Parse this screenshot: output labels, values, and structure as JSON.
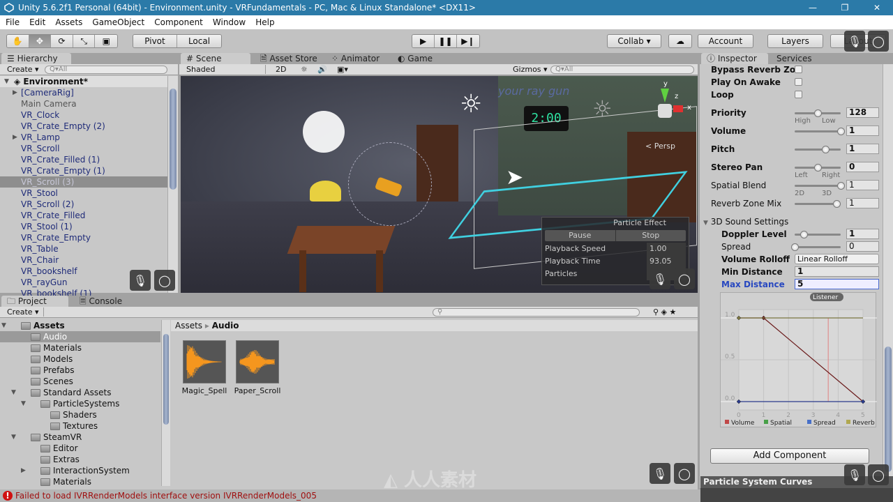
{
  "window": {
    "title": "Unity 5.6.2f1 Personal (64bit) - Environment.unity - VRFundamentals - PC, Mac & Linux Standalone* <DX11>",
    "minimize": "—",
    "maximize": "❐",
    "close": "✕"
  },
  "menu": [
    "File",
    "Edit",
    "Assets",
    "GameObject",
    "Component",
    "Window",
    "Help"
  ],
  "toolbar": {
    "tools": [
      "✋",
      "✥",
      "⟳",
      "⤡",
      "▣"
    ],
    "active_tool": 1,
    "pivot": "Pivot",
    "local": "Local",
    "play": "▶",
    "pause": "❚❚",
    "step": "▶❙",
    "collab": "Collab ▾",
    "cloud": "☁",
    "account": "Account",
    "layers": "Layers",
    "layout": "Layout"
  },
  "hierarchy": {
    "tab": "Hierarchy",
    "create": "Create ▾",
    "search_placeholder": "Q▾All",
    "scene": "Environment*",
    "selected": 8,
    "items": [
      {
        "label": "[CameraRig]",
        "expand": true,
        "color": "#1e2a78"
      },
      {
        "label": "Main Camera",
        "color": "#555555"
      },
      {
        "label": "VR_Clock"
      },
      {
        "label": "VR_Crate_Empty (2)"
      },
      {
        "label": "VR_Lamp",
        "expand": true
      },
      {
        "label": "VR_Scroll"
      },
      {
        "label": "VR_Crate_Filled (1)"
      },
      {
        "label": "VR_Crate_Empty (1)"
      },
      {
        "label": "VR_Scroll (3)"
      },
      {
        "label": "VR_Stool"
      },
      {
        "label": "VR_Scroll (2)"
      },
      {
        "label": "VR_Crate_Filled"
      },
      {
        "label": "VR_Stool (1)"
      },
      {
        "label": "VR_Crate_Empty"
      },
      {
        "label": "VR_Table"
      },
      {
        "label": "VR_Chair"
      },
      {
        "label": "VR_bookshelf"
      },
      {
        "label": "VR_rayGun"
      },
      {
        "label": "VR_bookshelf (1)"
      }
    ]
  },
  "scene": {
    "tabs": [
      "Scene",
      "Asset Store",
      "Animator",
      "Game"
    ],
    "shading": "Shaded",
    "mode_2d": "2D",
    "gizmos": "Gizmos ▾",
    "search_placeholder": "Q▾All",
    "clock": "2:00",
    "persp": "< Persp",
    "wall_text": "your ray gun",
    "axes": {
      "x": "x",
      "y": "y",
      "z": "z"
    },
    "particle_effect": {
      "title": "Particle Effect",
      "pause": "Pause",
      "stop": "Stop",
      "rows": [
        {
          "label": "Playback Speed",
          "value": "1.00"
        },
        {
          "label": "Playback Time",
          "value": "93.05"
        },
        {
          "label": "Particles",
          "value": ""
        }
      ]
    }
  },
  "inspector": {
    "tabs": [
      "Inspector",
      "Services"
    ],
    "bypass_reverb": {
      "label": "Bypass Reverb Zo",
      "checked": false
    },
    "play_on_awake": {
      "label": "Play On Awake",
      "checked": false
    },
    "loop": {
      "label": "Loop",
      "checked": false
    },
    "priority": {
      "label": "Priority",
      "value": "128",
      "fraction": 0.5,
      "min_label": "High",
      "max_label": "Low"
    },
    "volume": {
      "label": "Volume",
      "value": "1",
      "fraction": 1.0
    },
    "pitch": {
      "label": "Pitch",
      "value": "1",
      "fraction": 0.67
    },
    "stereo_pan": {
      "label": "Stereo Pan",
      "value": "0",
      "fraction": 0.5,
      "min_label": "Left",
      "max_label": "Right"
    },
    "spatial_blend": {
      "label": "Spatial Blend",
      "value": "1",
      "fraction": 1.0,
      "min_label": "2D",
      "max_label": "3D"
    },
    "reverb_zone_mix": {
      "label": "Reverb Zone Mix",
      "value": "1",
      "fraction": 0.91
    },
    "sound3d": {
      "label": "3D Sound Settings",
      "doppler": {
        "label": "Doppler Level",
        "value": "1",
        "fraction": 0.2
      },
      "spread": {
        "label": "Spread",
        "value": "0",
        "fraction": 0.0
      },
      "rolloff": {
        "label": "Volume Rolloff",
        "value": "Linear Rolloff"
      },
      "min_distance": {
        "label": "Min Distance",
        "value": "1"
      },
      "max_distance": {
        "label": "Max Distance",
        "value": "5"
      }
    },
    "add_component": "Add Component",
    "curves_header": "Particle System Curves"
  },
  "rolloff_graph": {
    "listener_label": "Listener",
    "listener_x": 3.6,
    "x_ticks": [
      "0",
      "1",
      "2",
      "3",
      "4",
      "5"
    ],
    "y_ticks": [
      "1.0",
      "0.5",
      "0.0"
    ],
    "xlim": [
      0,
      5
    ],
    "ylim": [
      0,
      1
    ],
    "legend": [
      {
        "name": "Volume",
        "color": "#c04848"
      },
      {
        "name": "Spatial",
        "color": "#48a048"
      },
      {
        "name": "Spread",
        "color": "#4870c8"
      },
      {
        "name": "Reverb",
        "color": "#b0a850"
      }
    ],
    "curves": [
      {
        "name": "Volume",
        "color": "#6a1a1a",
        "points": [
          [
            0,
            1
          ],
          [
            1,
            1
          ],
          [
            5,
            0
          ]
        ]
      },
      {
        "name": "Reverb",
        "color": "#7a7440",
        "points": [
          [
            0,
            1
          ],
          [
            5,
            1
          ]
        ]
      },
      {
        "name": "Spread",
        "color": "#2a3a8a",
        "points": [
          [
            0,
            0
          ],
          [
            5,
            0
          ]
        ]
      }
    ]
  },
  "project": {
    "tabs": [
      "Project",
      "Console"
    ],
    "create": "Create ▾",
    "search_placeholder": "",
    "tree": [
      {
        "label": "Assets",
        "depth": 0,
        "expanded": true,
        "bold": true
      },
      {
        "label": "Audio",
        "depth": 1,
        "selected": true
      },
      {
        "label": "Materials",
        "depth": 1
      },
      {
        "label": "Models",
        "depth": 1
      },
      {
        "label": "Prefabs",
        "depth": 1
      },
      {
        "label": "Scenes",
        "depth": 1
      },
      {
        "label": "Standard Assets",
        "depth": 1,
        "expanded": true
      },
      {
        "label": "ParticleSystems",
        "depth": 2,
        "expanded": true
      },
      {
        "label": "Shaders",
        "depth": 3
      },
      {
        "label": "Textures",
        "depth": 3
      },
      {
        "label": "SteamVR",
        "depth": 1,
        "expanded": true
      },
      {
        "label": "Editor",
        "depth": 2
      },
      {
        "label": "Extras",
        "depth": 2
      },
      {
        "label": "InteractionSystem",
        "depth": 2,
        "collapsed": true
      },
      {
        "label": "Materials",
        "depth": 2
      }
    ],
    "breadcrumb": [
      "Assets",
      "Audio"
    ],
    "assets": [
      {
        "name": "Magic_Spell"
      },
      {
        "name": "Paper_Scroll"
      }
    ]
  },
  "status": {
    "icon": "error-icon",
    "message": "Failed to load IVRRenderModels interface version IVRRenderModels_005"
  },
  "watermark": "人人素材"
}
